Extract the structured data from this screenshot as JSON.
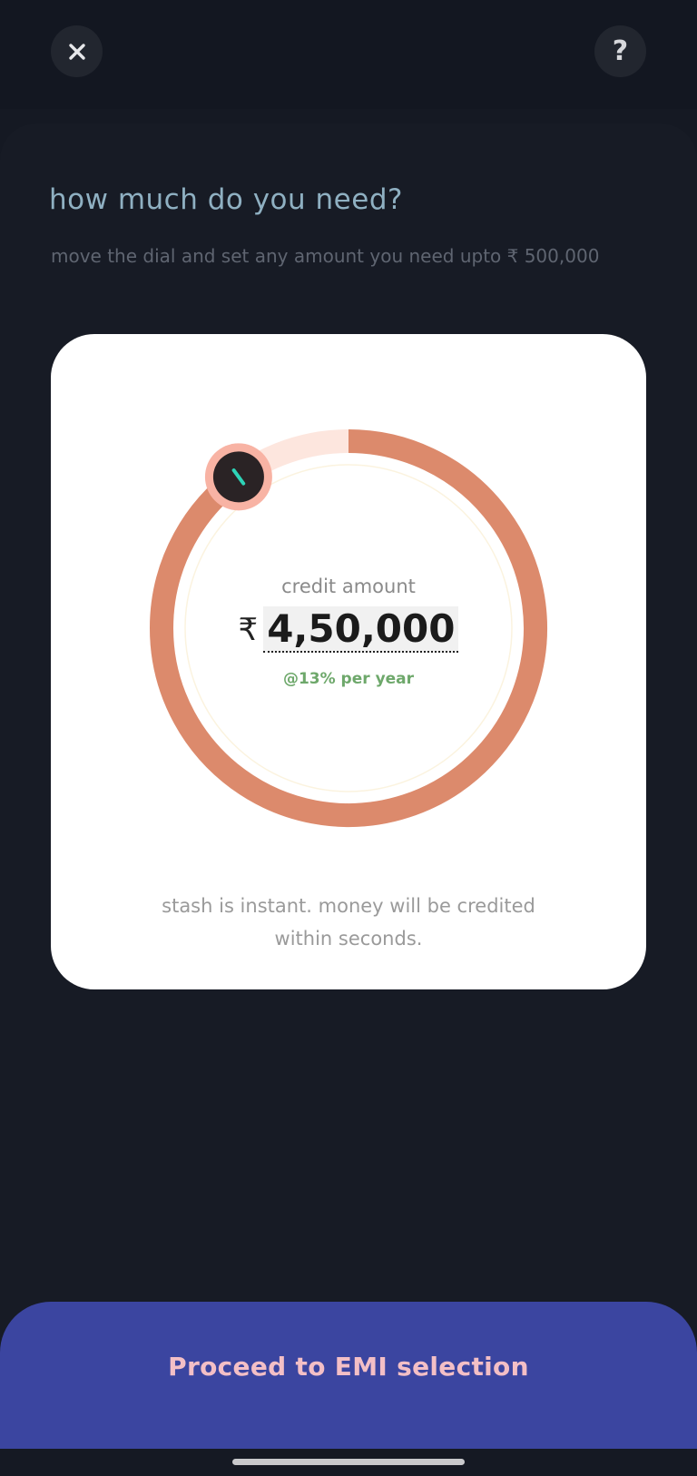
{
  "header": {
    "close_icon": "close-icon",
    "help_icon": "help-icon",
    "help_glyph": "?"
  },
  "content": {
    "title": "how much do you need?",
    "subtitle": "move the dial and set any amount you need upto ₹ 500,000"
  },
  "dial": {
    "label": "credit amount",
    "currency_symbol": "₹",
    "amount": "4,50,000",
    "rate": "@13% per year",
    "min": 0,
    "max": 500000,
    "value": 450000,
    "track_color": "#fde6de",
    "fill_color": "#dc8a6c",
    "knob_color": "#2a2325",
    "knob_ring_color": "#f8b3a4",
    "knob_tick_color": "#2ed3b7"
  },
  "card": {
    "note": "stash is instant. money will be credited within seconds."
  },
  "cta": {
    "label": "Proceed to EMI selection"
  },
  "colors": {
    "background": "#151923",
    "title": "#8fb0c2",
    "cta_bg": "#3b45a0",
    "cta_text": "#f3bfc6",
    "rate": "#6ea86b"
  }
}
